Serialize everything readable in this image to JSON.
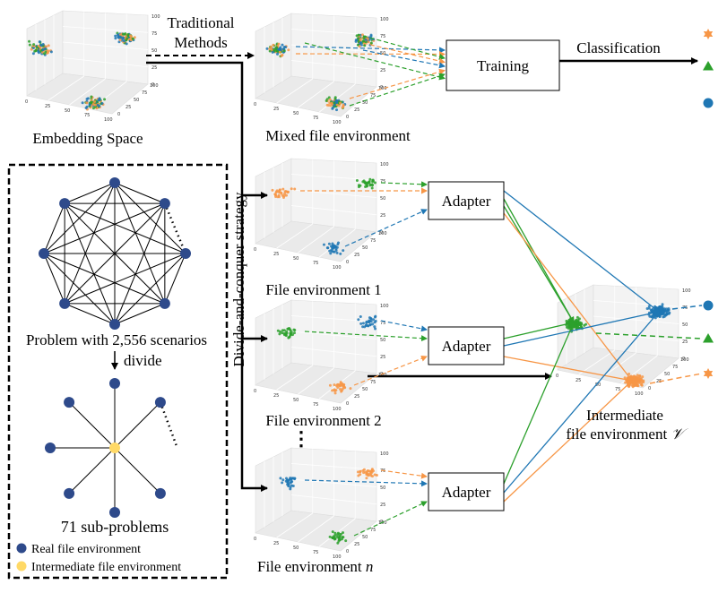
{
  "labels": {
    "traditional_methods_line1": "Traditional",
    "traditional_methods_line2": "Methods",
    "embedding_space": "Embedding Space",
    "mixed_env": "Mixed file environment",
    "training": "Training",
    "classification": "Classification",
    "divide_conquer": "Divide-and-conquer strategy",
    "env1": "File environment 1",
    "env2": "File environment 2",
    "envn": "File environment ",
    "envn_italic": "n",
    "adapter": "Adapter",
    "intermediate_line1": "Intermediate",
    "intermediate_line2": "file environment ",
    "intermediate_symbol": "𝒱",
    "ellipsis": "⋮",
    "problem": "Problem with 2,556 scenarios",
    "divide": "divide",
    "subproblems": "71 sub-problems",
    "legend_real": "Real file environment",
    "legend_intermediate": "Intermediate file environment"
  },
  "ticks": {
    "z": [
      "0",
      "25",
      "50",
      "75",
      "100"
    ],
    "x": [
      "0",
      "25",
      "50",
      "75",
      "100"
    ],
    "y": [
      "0",
      "25",
      "50",
      "75",
      "100"
    ]
  },
  "colors": {
    "blue": "#1f77b4",
    "orange": "#f79646",
    "green": "#2ca02c",
    "node_blue": "#2e4a8b",
    "node_yellow": "#ffd966"
  },
  "class_symbols": [
    "star",
    "triangle",
    "circle"
  ]
}
